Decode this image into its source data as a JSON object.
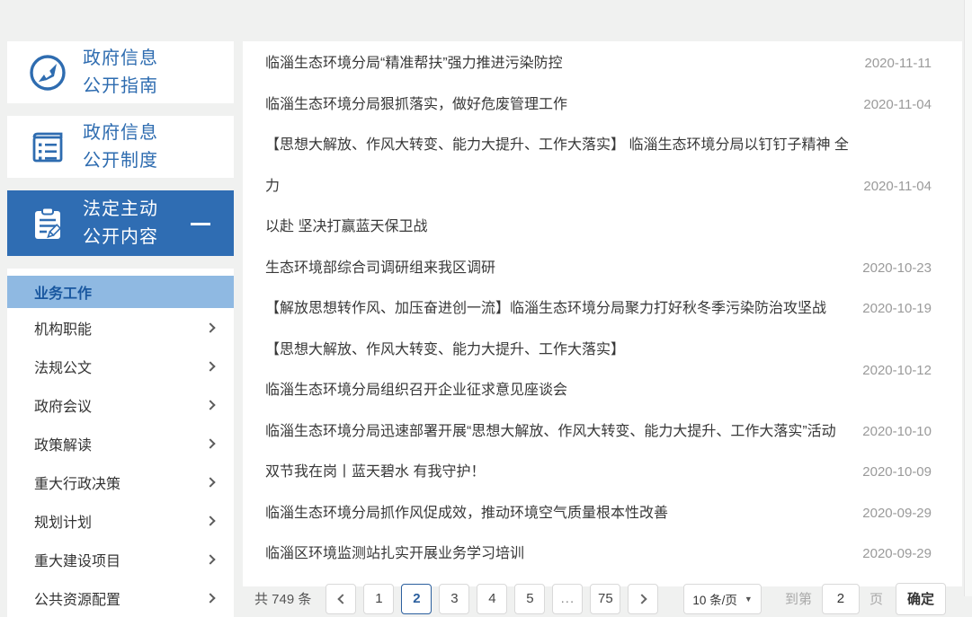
{
  "sidebar": {
    "cards": [
      {
        "icon": "compass-icon",
        "line1": "政府信息",
        "line2": "公开指南"
      },
      {
        "icon": "rulebook-icon",
        "line1": "政府信息",
        "line2": "公开制度"
      },
      {
        "icon": "clipboard-pencil-icon",
        "line1": "法定主动",
        "line2": "公开内容"
      }
    ],
    "menu": [
      {
        "label": "业务工作",
        "active": true
      },
      {
        "label": "机构职能",
        "active": false
      },
      {
        "label": "法规公文",
        "active": false
      },
      {
        "label": "政府会议",
        "active": false
      },
      {
        "label": "政策解读",
        "active": false
      },
      {
        "label": "重大行政决策",
        "active": false
      },
      {
        "label": "规划计划",
        "active": false
      },
      {
        "label": "重大建设项目",
        "active": false
      },
      {
        "label": "公共资源配置",
        "active": false
      }
    ]
  },
  "news_list": {
    "items": [
      {
        "title": "临淄生态环境分局“精准帮扶”强力推进污染防控",
        "date": "2020-11-11"
      },
      {
        "title": "临淄生态环境分局狠抓落实，做好危废管理工作",
        "date": "2020-11-04"
      },
      {
        "title": "【思想大解放、作风大转变、能力大提升、工作大落实】 临淄生态环境分局以钉钉子精神 全力\n以赴 坚决打赢蓝天保卫战",
        "date": "2020-11-04"
      },
      {
        "title": "生态环境部综合司调研组来我区调研",
        "date": "2020-10-23"
      },
      {
        "title": "【解放思想转作风、加压奋进创一流】临淄生态环境分局聚力打好秋冬季污染防治攻坚战",
        "date": "2020-10-19"
      },
      {
        "title": "【思想大解放、作风大转变、能力大提升、工作大落实】\n临淄生态环境分局组织召开企业征求意见座谈会",
        "date": "2020-10-12"
      },
      {
        "title": "临淄生态环境分局迅速部署开展“思想大解放、作风大转变、能力大提升、工作大落实”活动",
        "date": "2020-10-10"
      },
      {
        "title": "双节我在岗丨蓝天碧水 有我守护！",
        "date": "2020-10-09"
      },
      {
        "title": "临淄生态环境分局抓作风促成效，推动环境空气质量根本性改善",
        "date": "2020-09-29"
      },
      {
        "title": "临淄区环境监测站扎实开展业务学习培训",
        "date": "2020-09-29"
      }
    ]
  },
  "pagination": {
    "total": "共 749 条",
    "pages": [
      "1",
      "2",
      "3",
      "4",
      "5",
      "...",
      "75"
    ],
    "active_page": "2",
    "page_size": "10 条/页",
    "caret": "▼",
    "goto_label": "到第",
    "goto_value": "2",
    "goto_unit": "页",
    "confirm_label": "确定"
  },
  "colors": {
    "accent_blue": "#2f6db3",
    "highlight_blue": "#8fb9e2",
    "active_text_blue": "#19579f",
    "title_text": "#383838",
    "date_text": "#9a9a9a",
    "page_background": "#f0f1f0"
  }
}
